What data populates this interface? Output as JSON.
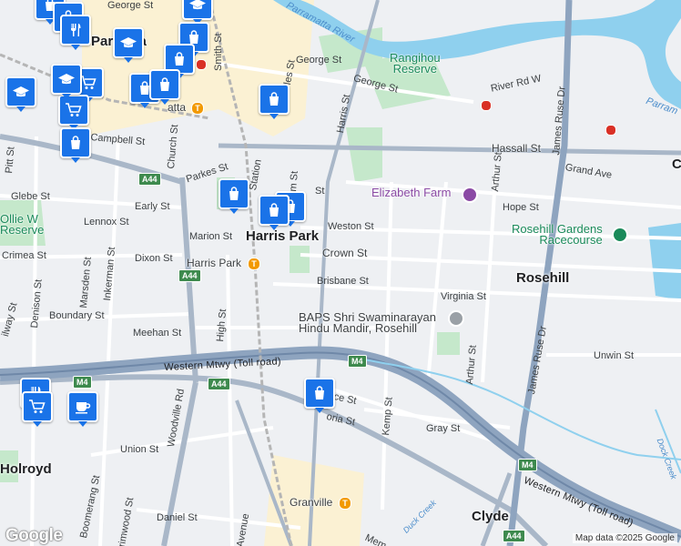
{
  "map": {
    "suburbs": {
      "harris_park": "Harris Park",
      "rosehill": "Rosehill",
      "holroyd": "Holroyd",
      "clyde": "Clyde",
      "parramatta_partial": "Parr   atta",
      "edge_c": "C"
    },
    "places": {
      "rangihou_reserve": "Rangihou\nReserve",
      "elizabeth_farm": "Elizabeth Farm",
      "rosehill_gardens": "Rosehill Gardens\nRacecourse",
      "ollie_webb_reserve": "Ollie W\nReserve",
      "baps_mandir": "BAPS Shri Swaminarayan\nHindu Mandir, Rosehill"
    },
    "waterways": {
      "parramatta_river": "Parramatta River",
      "parramatta_river_edge": "Parram",
      "duck_creek_a": "Duck Creek",
      "duck_creek_b": "Duck Creek"
    },
    "stations": {
      "parramatta": "atta",
      "harris_park": "Harris Park",
      "granville": "Granville"
    },
    "motorway": {
      "western_mtwy_1": "Western Mtwy (Toll road)",
      "western_mtwy_2": "Western Mtwy (Toll road)"
    },
    "shields": {
      "a44_1": "A44",
      "a44_2": "A44",
      "a44_3": "A44",
      "a44_4": "A44",
      "m4_1": "M4",
      "m4_2": "M4",
      "m4_3": "M4"
    },
    "streets": {
      "george_st_1": "George St",
      "george_st_2": "George St",
      "george_st_3": "George St",
      "smith_st": "Smith St",
      "harris_st": "Harris St",
      "river_rd_w": "River Rd W",
      "james_ruse_dr_1": "James Ruse Dr",
      "james_ruse_dr_2": "James Ruse Dr",
      "hassall_st": "Hassall St",
      "grand_ave": "Grand Ave",
      "campbell_st": "Campbell St",
      "church_st": "Church St",
      "pitt_st": "Pitt St",
      "parkes_st": "Parkes St",
      "station_st": "Station",
      "arthur_st_1": "Arthur St",
      "arthur_st_2": "Arthur St",
      "hope_st": "Hope St",
      "glebe_st": "Glebe St",
      "early_st": "Early St",
      "lennox_st": "Lennox St",
      "weston_st": "Weston St",
      "marion_st": "Marion St",
      "crimea_st": "Crimea St",
      "dixon_st": "Dixon St",
      "crown_st": "Crown St",
      "brisbane_st": "Brisbane St",
      "virginia_st": "Virginia St",
      "marsden_st": "Marsden St",
      "inkerman_st": "Inkerman St",
      "denison_st": "Denison St",
      "boundary_st": "Boundary St",
      "high_st": "High St",
      "meehan_st": "Meehan St",
      "unwin_st": "Unwin St",
      "railway_st": "ilway St",
      "woodville_rd": "Woodville Rd",
      "kemp_st": "Kemp St",
      "gray_st": "Gray St",
      "union_st": "Union St",
      "boomerang_st": "Boomerang St",
      "daniel_st": "Daniel St",
      "rimwood_st": "rimwood St",
      "avenue": "Avenue",
      "tam_st": "m St",
      "les_st": "les St",
      "st_partial": "St",
      "mem": "Mem",
      "ce_st": "ce St",
      "oria_st": "oria St",
      "dock_creek_edge": "Dock Creek"
    },
    "attribution": "Map data ©2025 Google",
    "logo": "Google",
    "colors": {
      "pin_blue": "#1a73e8",
      "motorway": "#8ea4bf",
      "major_road": "#a9b7c8",
      "water": "#8fd0ee",
      "park": "#c5e8cb",
      "cbd": "#fbf1d3",
      "station_orange": "#f29900",
      "metro_red": "#d93025",
      "shield_green": "#3e8a4e"
    },
    "markers": [
      {
        "id": "pin-1",
        "icon": "shopping-bag-icon"
      },
      {
        "id": "pin-2",
        "icon": "education-icon"
      },
      {
        "id": "pin-3",
        "icon": "shopping-bag-icon"
      },
      {
        "id": "pin-4",
        "icon": "restaurant-icon"
      },
      {
        "id": "pin-5",
        "icon": "education-icon"
      },
      {
        "id": "pin-6",
        "icon": "shopping-bag-icon"
      },
      {
        "id": "pin-7",
        "icon": "shopping-bag-icon"
      },
      {
        "id": "pin-8",
        "icon": "education-icon"
      },
      {
        "id": "pin-9",
        "icon": "shopping-cart-icon"
      },
      {
        "id": "pin-10",
        "icon": "shopping-bag-icon"
      },
      {
        "id": "pin-11",
        "icon": "shopping-bag-icon"
      },
      {
        "id": "pin-12",
        "icon": "shopping-cart-icon"
      },
      {
        "id": "pin-13",
        "icon": "shopping-bag-icon"
      },
      {
        "id": "pin-14",
        "icon": "shopping-bag-icon"
      },
      {
        "id": "pin-15",
        "icon": "shopping-bag-icon"
      },
      {
        "id": "pin-16",
        "icon": "shopping-bag-icon"
      },
      {
        "id": "pin-17",
        "icon": "shopping-bag-icon"
      },
      {
        "id": "pin-18",
        "icon": "shopping-bag-icon"
      },
      {
        "id": "pin-19",
        "icon": "restaurant-icon"
      },
      {
        "id": "pin-20",
        "icon": "shopping-cart-icon"
      },
      {
        "id": "pin-21",
        "icon": "coffee-icon"
      },
      {
        "id": "pin-22",
        "icon": "education-icon"
      }
    ]
  }
}
